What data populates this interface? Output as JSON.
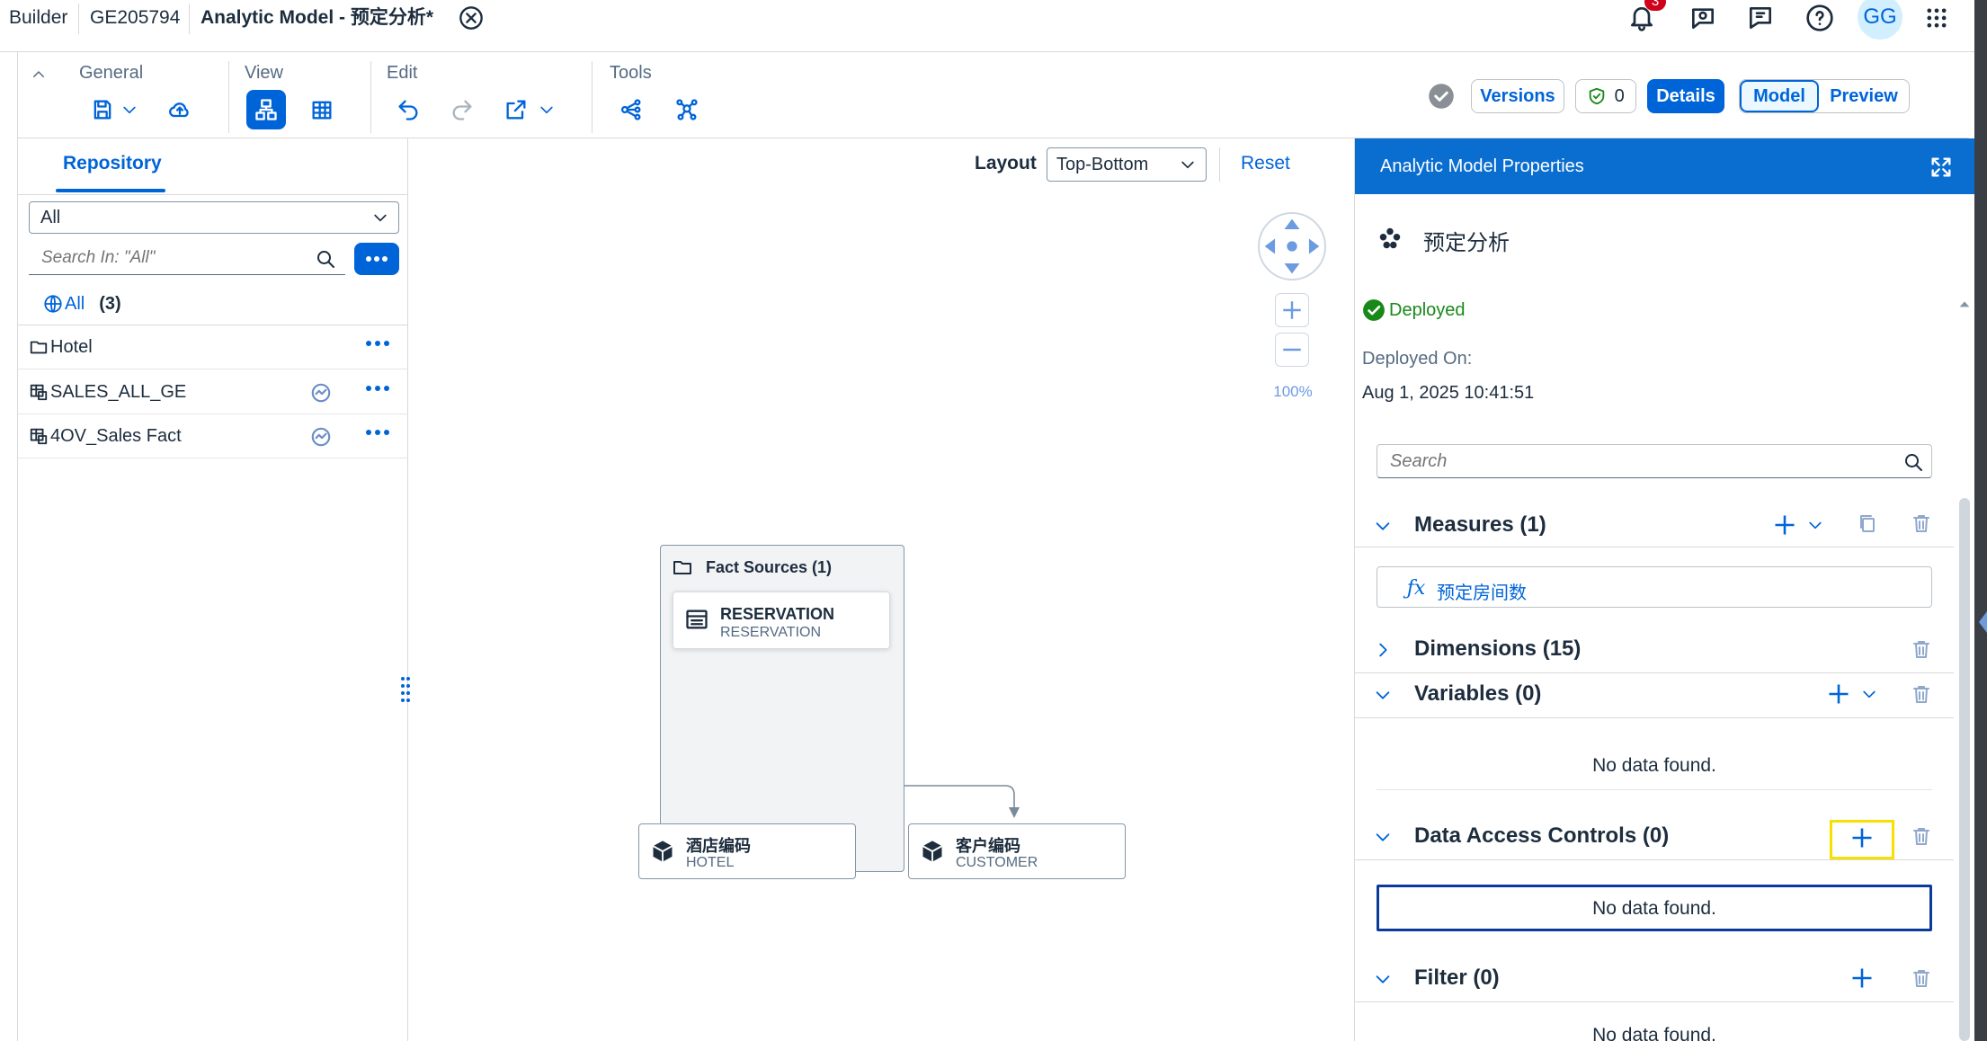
{
  "shell": {
    "tab_builder": "Builder",
    "tab_id": "GE205794",
    "tab_model": "Analytic Model - 预定分析*",
    "notification_count": "3",
    "avatar_initials": "GG"
  },
  "toolbar": {
    "general_label": "General",
    "view_label": "View",
    "edit_label": "Edit",
    "tools_label": "Tools",
    "versions_label": "Versions",
    "validation_count": "0",
    "details_label": "Details",
    "model_label": "Model",
    "preview_label": "Preview"
  },
  "repository": {
    "tab_label": "Repository",
    "filter_value": "All",
    "search_placeholder": "Search In: \"All\"",
    "all_label": "All",
    "all_count": "(3)",
    "items": [
      {
        "label": "Hotel",
        "type": "folder"
      },
      {
        "label": "SALES_ALL_GE",
        "type": "table"
      },
      {
        "label": "4OV_Sales Fact",
        "type": "table"
      }
    ]
  },
  "canvas": {
    "layout_label": "Layout",
    "layout_value": "Top-Bottom",
    "reset_label": "Reset",
    "zoom_level": "100%",
    "fact_sources_label": "Fact Sources (1)",
    "fact_node_title": "RESERVATION",
    "fact_node_subtitle": "RESERVATION",
    "dim_nodes": [
      {
        "title": "酒店编码",
        "subtitle": "HOTEL"
      },
      {
        "title": "客户编码",
        "subtitle": "CUSTOMER"
      }
    ]
  },
  "properties": {
    "panel_title": "Analytic Model Properties",
    "model_name": "预定分析",
    "status": "Deployed",
    "deployed_on_label": "Deployed On:",
    "deployed_on_value": "Aug 1, 2025 10:41:51",
    "search_placeholder": "Search",
    "measures_title": "Measures (1)",
    "measure_item": "预定房间数",
    "dimensions_title": "Dimensions (15)",
    "variables_title": "Variables (0)",
    "variables_empty": "No data found.",
    "dac_title": "Data Access Controls (0)",
    "dac_empty": "No data found.",
    "filter_title": "Filter (0)",
    "filter_empty": "No data found."
  },
  "colors": {
    "accent": "#0064d9",
    "panel_header": "#0a6ed1",
    "success": "#188918",
    "highlight": "#f5e000",
    "badge": "#d0021b"
  }
}
